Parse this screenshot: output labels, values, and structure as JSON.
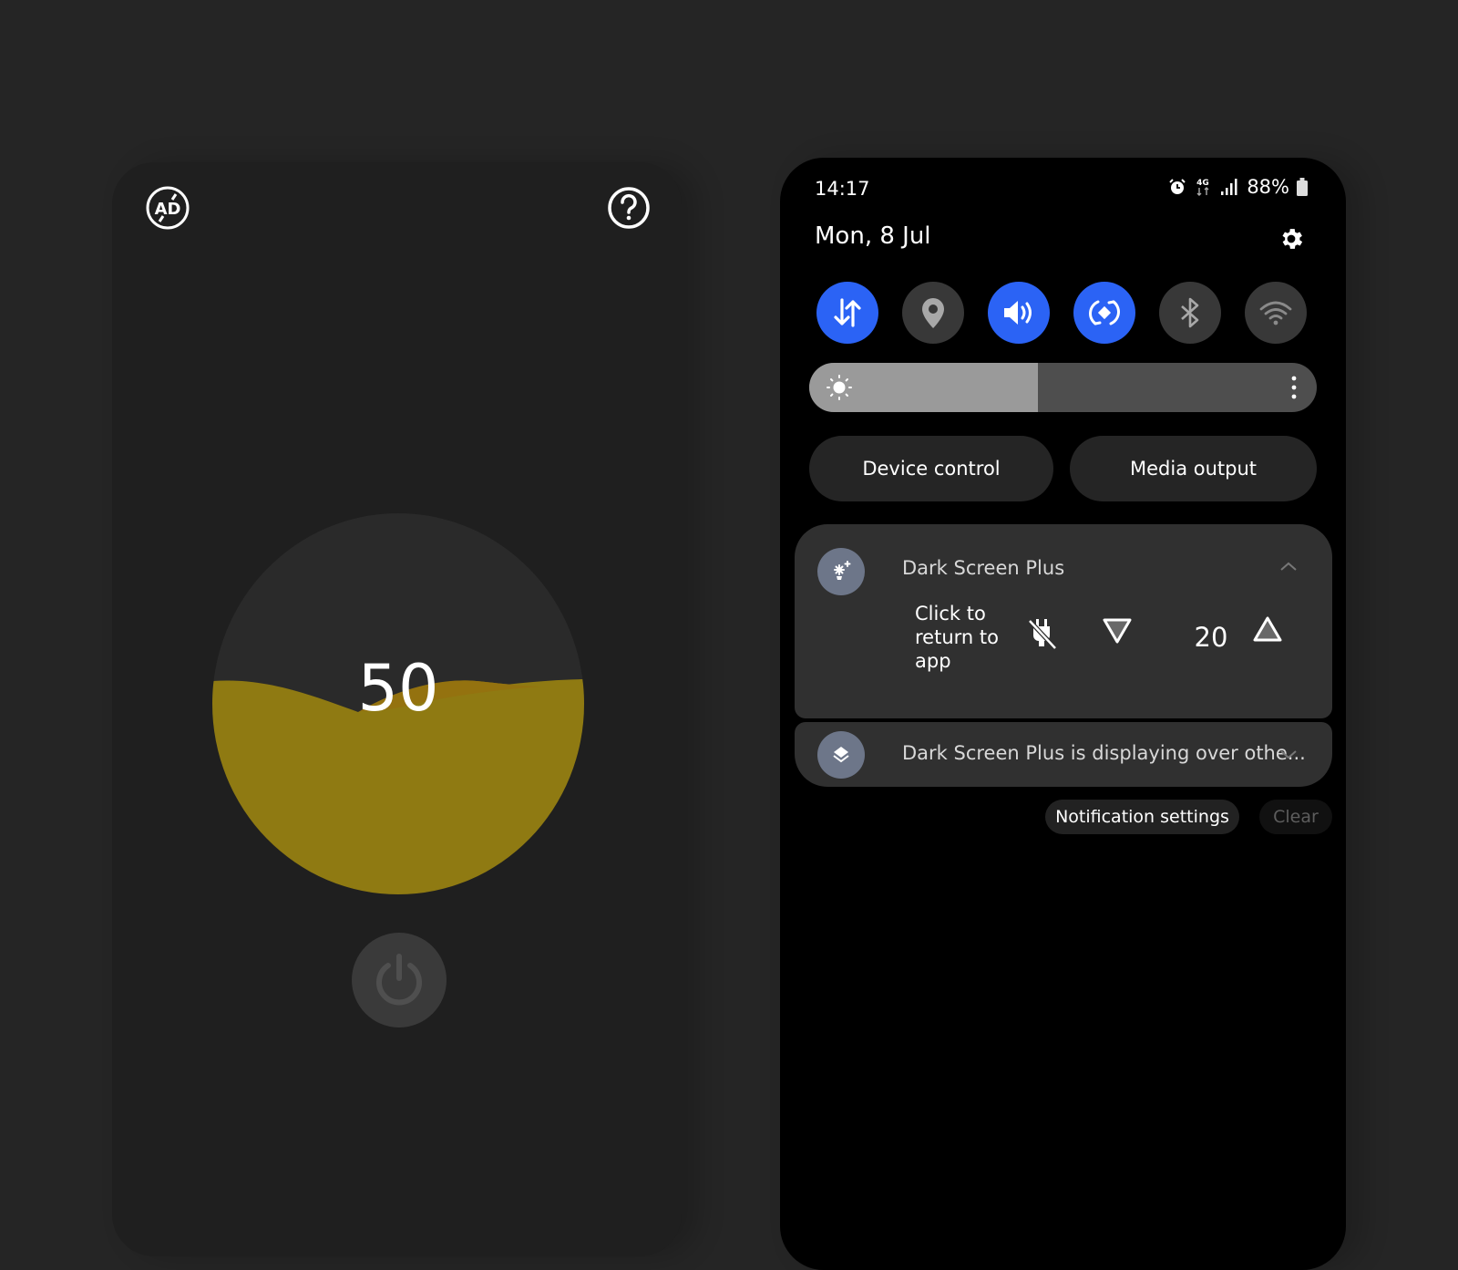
{
  "left_app": {
    "ad_icon": "no-ads-icon",
    "help_icon": "help-icon",
    "gauge": {
      "value_label": "50",
      "fill_percent": 50,
      "fill_color": "#8f7a12",
      "back_wave_color": "#94720f",
      "track_color": "#2a2a2a"
    },
    "power_icon": "power-icon"
  },
  "quick_panel": {
    "status_bar": {
      "time": "14:17",
      "network": "4G",
      "battery": "88%"
    },
    "date": "Mon, 8 Jul",
    "toggles": [
      {
        "name": "mobile-data",
        "icon": "data-arrows-icon",
        "on": true
      },
      {
        "name": "location",
        "icon": "location-pin-icon",
        "on": false
      },
      {
        "name": "sound",
        "icon": "speaker-icon",
        "on": true
      },
      {
        "name": "auto-rotate",
        "icon": "rotate-icon",
        "on": true
      },
      {
        "name": "bluetooth",
        "icon": "bluetooth-icon",
        "on": false
      },
      {
        "name": "wifi",
        "icon": "wifi-icon",
        "on": false
      }
    ],
    "brightness_fraction": 0.45,
    "accent_color": "#2b63f5",
    "buttons": {
      "device_control": "Device control",
      "media_output": "Media output"
    },
    "notifications": [
      {
        "app": "Dark Screen Plus",
        "body": "Click to return to app",
        "level": "20"
      },
      {
        "text": "Dark Screen Plus is displaying over othe..."
      }
    ],
    "footer": {
      "notification_settings": "Notification settings",
      "clear": "Clear"
    }
  }
}
